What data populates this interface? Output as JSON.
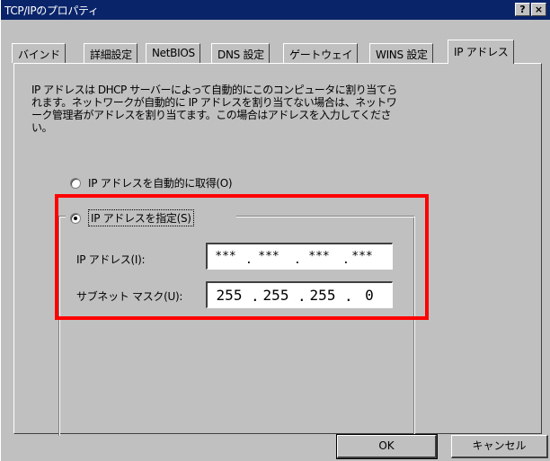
{
  "window": {
    "title": "TCP/IPのプロパティ",
    "help_button": "?",
    "close_button": "×"
  },
  "tabs": [
    {
      "label": "バインド",
      "active": false
    },
    {
      "label": "詳細設定",
      "active": false
    },
    {
      "label": "NetBIOS",
      "active": false
    },
    {
      "label": "DNS 設定",
      "active": false
    },
    {
      "label": "ゲートウェイ",
      "active": false
    },
    {
      "label": "WINS 設定",
      "active": false
    },
    {
      "label": "IP アドレス",
      "active": true
    }
  ],
  "description": {
    "line1": "IP アドレスは DHCP サーバーによって自動的にこのコンピュータに割り当てら",
    "line2": "れます。ネットワークが自動的に IP アドレスを割り当てない場合は、ネットワ",
    "line3": "ーク管理者がアドレスを割り当てます。この場合はアドレスを入力してくださ",
    "line4": "い。"
  },
  "radio_auto": {
    "label": "IP アドレスを自動的に取得(O)",
    "checked": false
  },
  "radio_manual": {
    "label": "IP アドレスを指定(S)",
    "checked": true
  },
  "ip_address": {
    "label": "IP アドレス(I):",
    "octets": [
      "***",
      "***",
      "***",
      "***"
    ]
  },
  "subnet_mask": {
    "label": "サブネット マスク(U):",
    "octets": [
      "255",
      "255",
      "255",
      "0"
    ]
  },
  "buttons": {
    "ok": "OK",
    "cancel": "キャンセル"
  },
  "colors": {
    "highlight": "#ff0000",
    "titlebar": "#0a246a",
    "face": "#c0c0c0"
  }
}
